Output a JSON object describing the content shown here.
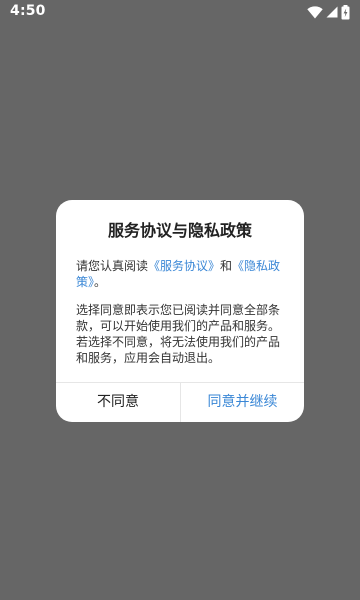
{
  "status_bar": {
    "time": "4:50"
  },
  "dialog": {
    "title": "服务协议与隐私政策",
    "para1": {
      "prefix": "请您认真阅读",
      "link1": "《服务协议》",
      "middle": "和",
      "link2": "《隐私政策》",
      "suffix": "。"
    },
    "para2": "选择同意即表示您已阅读并同意全部条款，可以开始使用我们的产品和服务。若选择不同意，将无法使用我们的产品和服务，应用会自动退出。",
    "disagree_label": "不同意",
    "agree_label": "同意并继续"
  },
  "colors": {
    "overlay": "#666666",
    "link": "#3a87d6",
    "dialog_bg": "#ffffff"
  },
  "icons": [
    "wifi-icon",
    "cellular-signal-icon",
    "battery-charging-icon"
  ]
}
